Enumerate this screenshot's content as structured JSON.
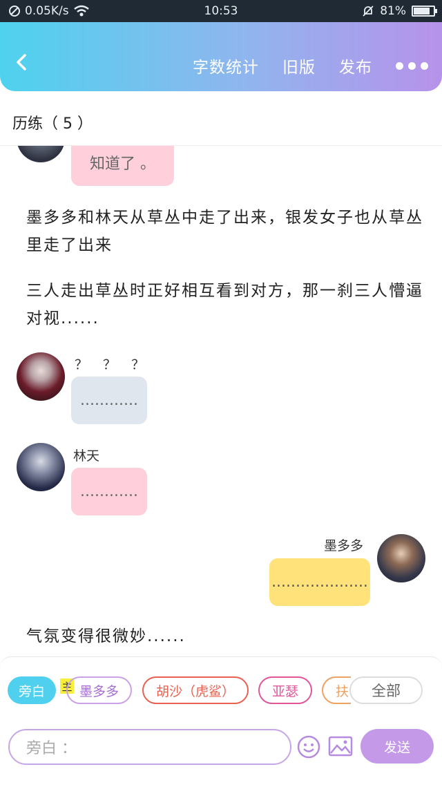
{
  "status_bar": {
    "net_speed": "0.05K/s",
    "time": "10:53",
    "battery": "81%",
    "battery_level": 0.81
  },
  "header": {
    "links": [
      "字数统计",
      "旧版",
      "发布"
    ]
  },
  "section": {
    "title": "历练（ 5 ）"
  },
  "chat": {
    "top_bubble": "知道了 。",
    "narration_1": "墨多多和林天从草丛中走了出来，银发女子也从草丛里走了出来",
    "narration_2": "三人走出草丛时正好相互看到对方，那一刹三人懵逼对视......",
    "msg_1": {
      "name": "？ ？ ？",
      "text": "............"
    },
    "msg_2": {
      "name": "林天",
      "text": "............"
    },
    "msg_3": {
      "name": "墨多多",
      "text": "...................."
    },
    "narration_3": "气氛变得很微妙......"
  },
  "roles": {
    "chips": [
      "旁白",
      "墨多多",
      "胡沙（虎鲨）",
      "亚瑟",
      "扶"
    ],
    "main_tag": "主",
    "all_label": "全部"
  },
  "composer": {
    "placeholder": "旁白 ：",
    "send_label": "发送"
  },
  "colors": {
    "pink_bubble": "#ffcfdb",
    "grey_bubble": "#dfe6ee",
    "yellow_bubble": "#ffe27a",
    "accent": "#c49ae8"
  }
}
